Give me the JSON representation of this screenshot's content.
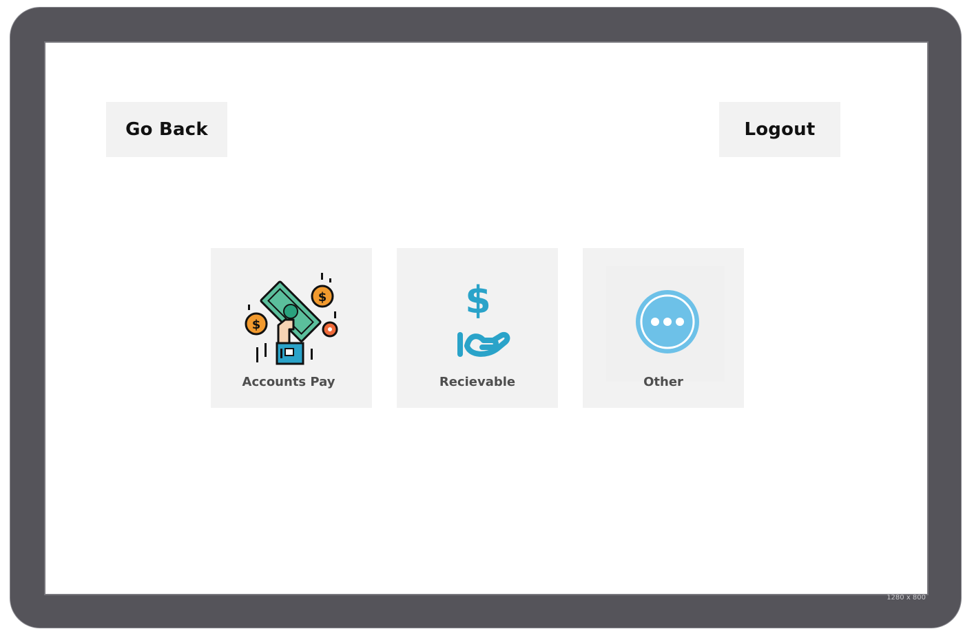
{
  "screen": {
    "size_label": "1280 x 800"
  },
  "header": {
    "back_label": "Go Back",
    "logout_label": "Logout"
  },
  "tiles": [
    {
      "label": "Accounts Pay",
      "icon": "money-hand-icon"
    },
    {
      "label": "Recievable",
      "icon": "dollar-receive-hand-icon"
    },
    {
      "label": "Other",
      "icon": "more-dots-icon"
    }
  ],
  "colors": {
    "device_frame": "#55545a",
    "button_bg": "#f2f2f2",
    "bill_green": "#5bbf9c",
    "coin_orange": "#f29a2e",
    "receive_teal": "#2aa3c9",
    "other_blue": "#6dc1e8"
  }
}
